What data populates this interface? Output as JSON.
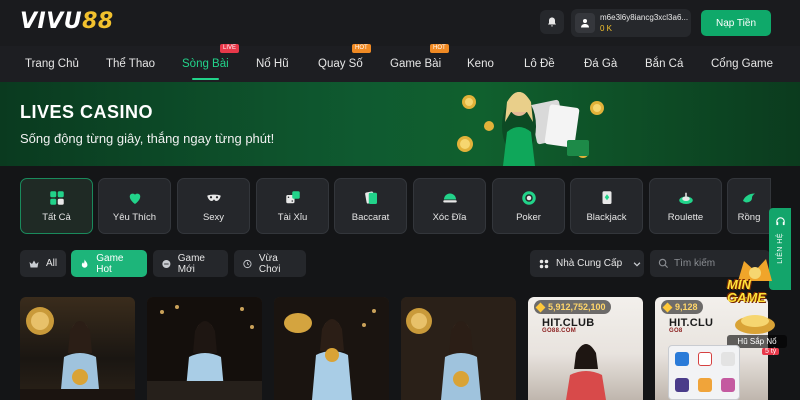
{
  "header": {
    "logo_part1": "VIVU",
    "logo_part2": "88",
    "username": "m6e3l6y8iancg3xcl3a6...",
    "balance": "0 K",
    "deposit_label": "Nạp Tiền"
  },
  "nav": {
    "items": [
      {
        "label": "Trang Chủ"
      },
      {
        "label": "Thể Thao"
      },
      {
        "label": "Sòng Bài",
        "badge": "LIVE",
        "active": true
      },
      {
        "label": "Nổ Hũ"
      },
      {
        "label": "Quay Số",
        "badge": "HOT"
      },
      {
        "label": "Game Bài",
        "badge": "HOT"
      },
      {
        "label": "Keno"
      },
      {
        "label": "Lô Đề"
      },
      {
        "label": "Đá Gà"
      },
      {
        "label": "Bắn Cá"
      },
      {
        "label": "Cổng Game"
      }
    ]
  },
  "banner": {
    "title": "LIVES CASINO",
    "subtitle": "Sống động từng giây, thắng ngay từng phút!"
  },
  "categories": [
    {
      "label": "Tất Cả",
      "icon": "grid-icon",
      "active": true
    },
    {
      "label": "Yêu Thích",
      "icon": "heart-icon"
    },
    {
      "label": "Sexy",
      "icon": "mask-icon"
    },
    {
      "label": "Tài Xỉu",
      "icon": "dice-icon"
    },
    {
      "label": "Baccarat",
      "icon": "cards-icon"
    },
    {
      "label": "Xóc Đĩa",
      "icon": "bowl-icon"
    },
    {
      "label": "Poker",
      "icon": "chip-icon"
    },
    {
      "label": "Blackjack",
      "icon": "blackjack-icon"
    },
    {
      "label": "Roulette",
      "icon": "roulette-icon"
    },
    {
      "label": "Rồng",
      "icon": "dragon-icon"
    }
  ],
  "filters": {
    "chips": [
      {
        "label": "All",
        "icon": "crown-icon"
      },
      {
        "label": "Game Hot",
        "icon": "fire-icon",
        "active": true
      },
      {
        "label": "Game Mới",
        "icon": "new-icon"
      },
      {
        "label": "Vừa Chơi",
        "icon": "history-icon"
      }
    ],
    "provider_label": "Nhà Cung Cấp",
    "search_placeholder": "Tìm kiếm"
  },
  "side_tab": {
    "label": "LIÊN HỆ"
  },
  "cards": [
    {
      "style": "dark"
    },
    {
      "style": "dark"
    },
    {
      "style": "dark"
    },
    {
      "style": "dark"
    },
    {
      "style": "light",
      "jackpot": "5,912,752,100",
      "brand": "HIT.CLUB",
      "brand_sub": "GO88.COM"
    },
    {
      "style": "light",
      "jackpot": "9,128",
      "brand": "HIT.CLU",
      "brand_sub": "GO8"
    }
  ],
  "promo": {
    "title_line1": "MIN",
    "title_line2": "GAME",
    "subtitle": "Hũ Sắp Nổ",
    "badge": "5 tỷ"
  },
  "colors": {
    "accent": "#1db57a",
    "brand_gold": "#f2c12e",
    "background": "#141517",
    "live_badge": "#e8384a",
    "hot_badge": "#f08a24"
  }
}
